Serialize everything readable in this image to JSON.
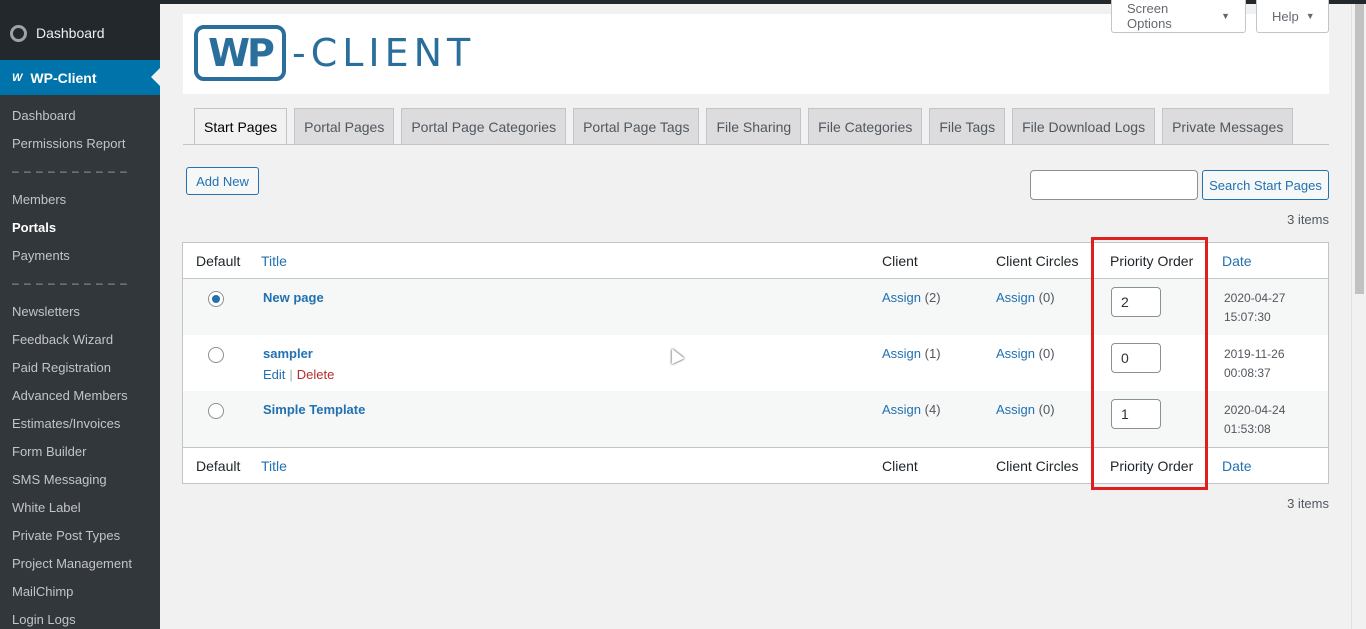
{
  "sidebar": {
    "dashboard": "Dashboard",
    "wpclient": "WP-Client",
    "items": [
      {
        "label": "Dashboard"
      },
      {
        "label": "Permissions Report"
      },
      {
        "label": "– – – – – – – – – –"
      },
      {
        "label": "Members"
      },
      {
        "label": "Portals"
      },
      {
        "label": "Payments"
      },
      {
        "label": "– – – – – – – – – –"
      },
      {
        "label": "Newsletters"
      },
      {
        "label": "Feedback Wizard"
      },
      {
        "label": "Paid Registration"
      },
      {
        "label": "Advanced Members"
      },
      {
        "label": "Estimates/Invoices"
      },
      {
        "label": "Form Builder"
      },
      {
        "label": "SMS Messaging"
      },
      {
        "label": "White Label"
      },
      {
        "label": "Private Post Types"
      },
      {
        "label": "Project Management"
      },
      {
        "label": "MailChimp"
      },
      {
        "label": "Login Logs"
      }
    ]
  },
  "header": {
    "logo_wp": "WP",
    "logo_rest": "-CLIENT",
    "screen_options": "Screen Options",
    "help": "Help"
  },
  "tabs": [
    {
      "label": "Start Pages"
    },
    {
      "label": "Portal Pages"
    },
    {
      "label": "Portal Page Categories"
    },
    {
      "label": "Portal Page Tags"
    },
    {
      "label": "File Sharing"
    },
    {
      "label": "File Categories"
    },
    {
      "label": "File Tags"
    },
    {
      "label": "File Download Logs"
    },
    {
      "label": "Private Messages"
    }
  ],
  "toolbar": {
    "add_new": "Add New",
    "search_button": "Search Start Pages",
    "search_value": "",
    "items_count": "3 items"
  },
  "table": {
    "columns": {
      "default": "Default",
      "title": "Title",
      "client": "Client",
      "circles": "Client Circles",
      "priority": "Priority Order",
      "date": "Date"
    },
    "rows": [
      {
        "title": "New page",
        "client": "Assign",
        "client_n": "(2)",
        "circles": "Assign",
        "circles_n": "(0)",
        "priority": "2",
        "date1": "2020-04-27",
        "date2": "15:07:30",
        "default": true
      },
      {
        "title": "sampler",
        "client": "Assign",
        "client_n": "(1)",
        "circles": "Assign",
        "circles_n": "(0)",
        "priority": "0",
        "date1": "2019-11-26",
        "date2": "00:08:37",
        "edit": "Edit",
        "sep": "|",
        "delete": "Delete",
        "default": false
      },
      {
        "title": "Simple Template",
        "client": "Assign",
        "client_n": "(4)",
        "circles": "Assign",
        "circles_n": "(0)",
        "priority": "1",
        "date1": "2020-04-24",
        "date2": "01:53:08",
        "default": false
      }
    ]
  },
  "colors": {
    "accent": "#0073aa",
    "link": "#2271b1",
    "highlight": "#dd1f1f"
  }
}
